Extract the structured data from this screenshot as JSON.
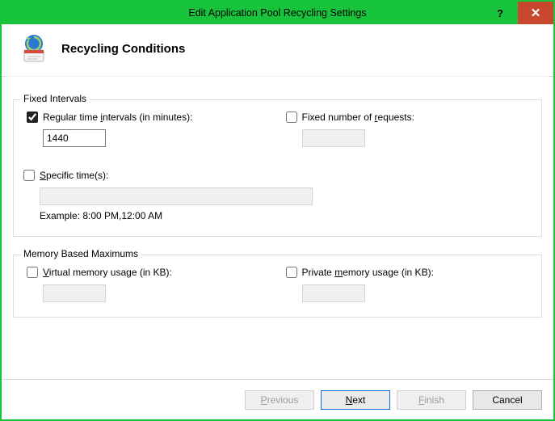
{
  "window": {
    "title": "Edit Application Pool Recycling Settings"
  },
  "header": {
    "title": "Recycling Conditions"
  },
  "group_intervals": {
    "legend": "Fixed Intervals",
    "regular": {
      "checked": true,
      "label_pre": "Regular time ",
      "label_u": "i",
      "label_post": "ntervals (in minutes):",
      "value": "1440"
    },
    "requests": {
      "checked": false,
      "label_pre": "Fixed number of ",
      "label_u": "r",
      "label_post": "equests:",
      "value": ""
    },
    "times": {
      "checked": false,
      "label_u": "S",
      "label_post": "pecific time(s):",
      "value": "",
      "example": "Example: 8:00 PM,12:00 AM"
    }
  },
  "group_memory": {
    "legend": "Memory Based Maximums",
    "virtual": {
      "checked": false,
      "label_u": "V",
      "label_post": "irtual memory usage (in KB):",
      "value": ""
    },
    "private": {
      "checked": false,
      "label_pre": "Private ",
      "label_u": "m",
      "label_post": "emory usage (in KB):",
      "value": ""
    }
  },
  "buttons": {
    "previous_u": "P",
    "previous_post": "revious",
    "next_u": "N",
    "next_post": "ext",
    "finish_u": "F",
    "finish_post": "inish",
    "cancel": "Cancel"
  },
  "titlebar": {
    "help": "?",
    "close": "✕"
  }
}
